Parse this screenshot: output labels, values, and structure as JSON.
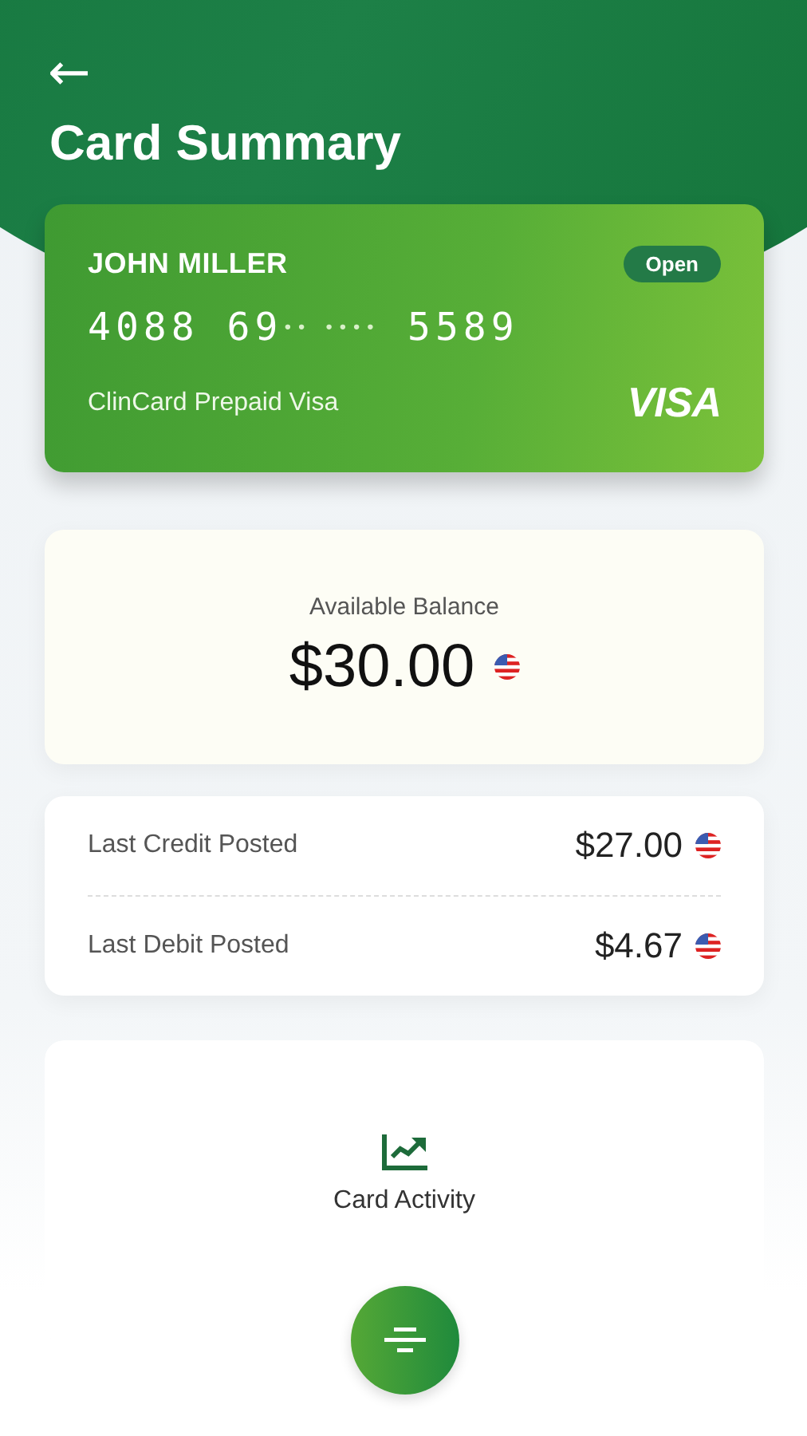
{
  "header": {
    "back": "←",
    "title": "Card Summary"
  },
  "card": {
    "holder": "JOHN MILLER",
    "status": "Open",
    "number_start": "4088 69",
    "number_mask": "•• ••••",
    "number_end": "5589",
    "product": "ClinCard Prepaid Visa",
    "brand": "VISA"
  },
  "balance": {
    "label": "Available Balance",
    "amount": "$30.00"
  },
  "postings": [
    {
      "label": "Last Credit Posted",
      "amount": "$27.00"
    },
    {
      "label": "Last Debit Posted",
      "amount": "$4.67"
    }
  ],
  "activity": {
    "label": "Card Activity"
  }
}
